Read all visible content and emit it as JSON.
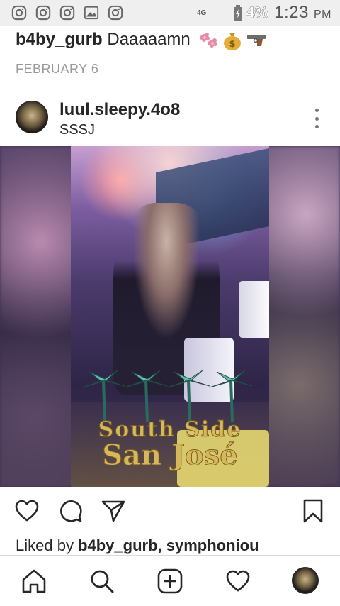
{
  "status_bar": {
    "network": "4G",
    "battery": "4%",
    "time": "1:23",
    "ampm": "PM",
    "notification_icons": [
      "instagram-icon",
      "instagram-icon",
      "instagram-icon",
      "image-icon",
      "instagram-icon"
    ]
  },
  "caption": {
    "username": "b4by_gurb",
    "text": "Daaaaamn",
    "emojis": [
      "flowers-emoji",
      "money-bag-emoji",
      "pistol-emoji"
    ],
    "date": "FEBRUARY 6"
  },
  "post": {
    "username": "luul.sleepy.4o8",
    "location": "SSSJ",
    "image_overlay_line1": "South Side",
    "image_overlay_line2": "San José"
  },
  "actions": {
    "icons": [
      "heart-icon",
      "comment-icon",
      "share-icon",
      "bookmark-icon"
    ],
    "liked_by_prefix": "Liked by ",
    "liked_by_users": "b4by_gurb, symphoniou"
  },
  "bottom_nav": {
    "items": [
      "home-icon",
      "search-icon",
      "new-post-icon",
      "activity-icon",
      "profile-icon"
    ]
  }
}
